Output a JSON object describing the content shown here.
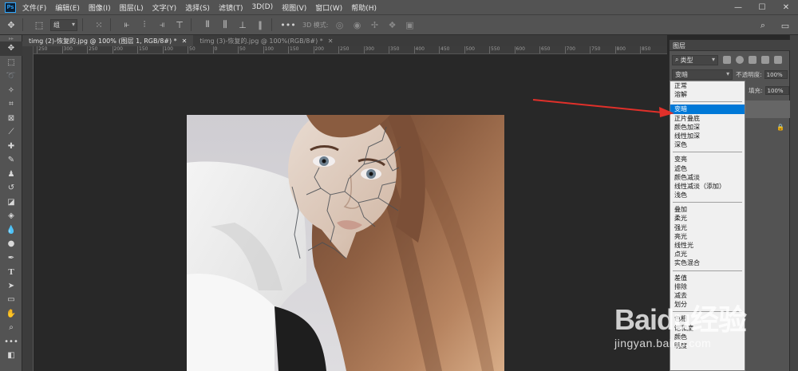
{
  "menubar": {
    "logo": "Ps",
    "items": [
      "文件(F)",
      "编辑(E)",
      "图像(I)",
      "图层(L)",
      "文字(Y)",
      "选择(S)",
      "滤镜(T)",
      "3D(D)",
      "视图(V)",
      "窗口(W)",
      "帮助(H)"
    ],
    "window_controls": [
      "—",
      "☐",
      "✕"
    ]
  },
  "options": {
    "group_select": "组",
    "mode_3d": "3D 模式:",
    "icons": [
      "move-icon",
      "auto-select-icon",
      "align-icons",
      "distribute-icons",
      "more-icon",
      "search-icon",
      "workspace-icon"
    ]
  },
  "tabs": [
    {
      "label": "timg (2)-恢复的.jpg @ 100% (图层 1, RGB/8#) *",
      "active": true
    },
    {
      "label": "timg (3)-恢复的.jpg @ 100%(RGB/8#) *",
      "active": false
    }
  ],
  "ruler": {
    "h_ticks": [
      "250",
      "300",
      "250",
      "200",
      "150",
      "100",
      "50",
      "0",
      "50",
      "100",
      "150",
      "200",
      "250",
      "300",
      "350",
      "400",
      "450",
      "500",
      "550",
      "600",
      "650",
      "700",
      "750",
      "800",
      "850"
    ]
  },
  "layers_panel": {
    "tab_label": "图层",
    "filter_label": "类型",
    "blend_mode": "变暗",
    "opacity_label": "不透明度:",
    "opacity_value": "100%",
    "fill_label": "填充:",
    "fill_value": "100%"
  },
  "blend_dropdown": {
    "groups": [
      [
        "正常",
        "溶解"
      ],
      [
        "变暗",
        "正片叠底",
        "颜色加深",
        "线性加深",
        "深色"
      ],
      [
        "变亮",
        "滤色",
        "颜色减淡",
        "线性减淡（添加）",
        "浅色"
      ],
      [
        "叠加",
        "柔光",
        "强光",
        "亮光",
        "线性光",
        "点光",
        "实色混合"
      ],
      [
        "差值",
        "排除",
        "减去",
        "划分"
      ],
      [
        "色相",
        "饱和度",
        "颜色",
        "明度"
      ]
    ],
    "selected": "变暗"
  },
  "watermark": {
    "logo": "Baidu经验",
    "sub": "jingyan.baidu.com"
  },
  "colors": {
    "selection": "#0078d7",
    "arrow": "#e0302a",
    "ui_gray": "#535353",
    "canvas_bg": "#282828"
  }
}
